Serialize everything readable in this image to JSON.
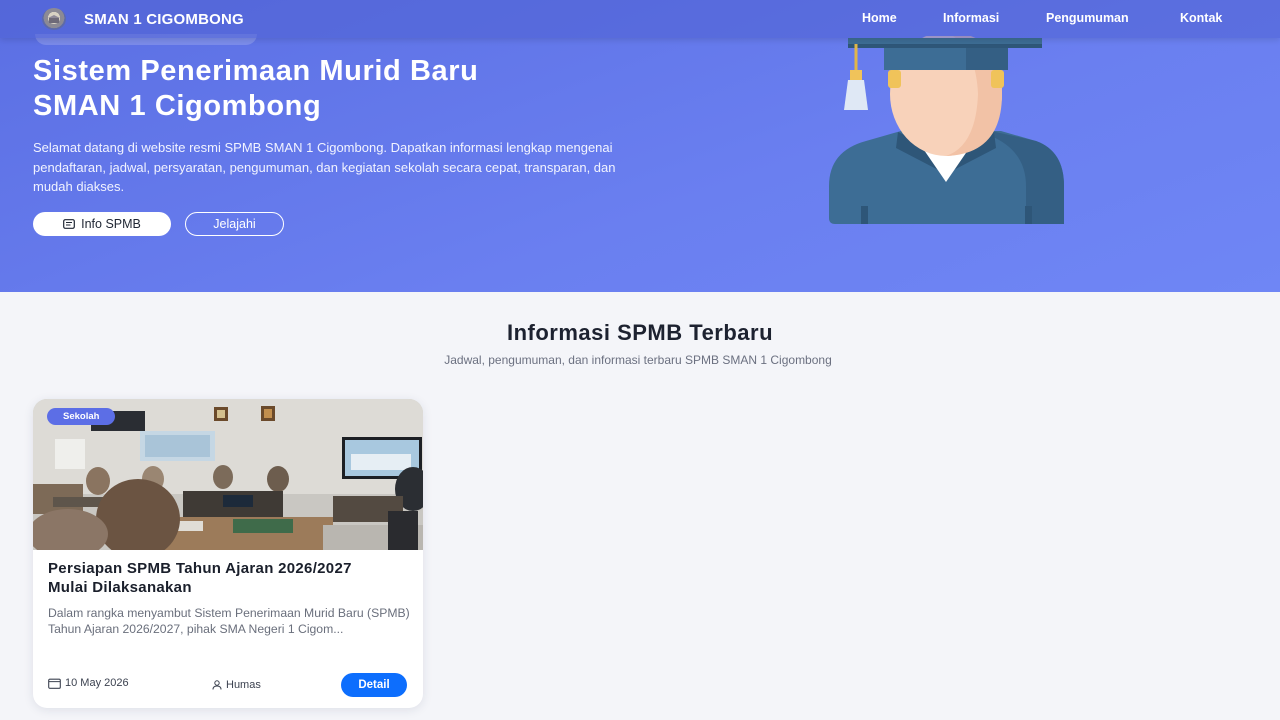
{
  "nav": {
    "brand": "SMAN 1 CIGOMBONG",
    "links": [
      "Home",
      "Informasi",
      "Pengumuman",
      "Kontak"
    ]
  },
  "hero": {
    "title_line1": "Sistem Penerimaan Murid Baru",
    "title_line2": "SMAN 1 Cigombong",
    "description": "Selamat datang di website resmi SPMB SMAN 1 Cigombong. Dapatkan informasi lengkap mengenai pendaftaran, jadwal, persyaratan, pengumuman, dan kegiatan sekolah secara cepat, transparan, dan mudah diakses.",
    "primary_button": "Info SPMB",
    "secondary_button": "Jelajahi",
    "illustration": "graduate-icon"
  },
  "section": {
    "title": "Informasi SPMB Terbaru",
    "subtitle": "Jadwal, pengumuman, dan informasi terbaru SPMB SMAN 1 Cigombong"
  },
  "posts": [
    {
      "category": "Sekolah",
      "title": "Persiapan SPMB Tahun Ajaran 2026/2027 Mulai Dilaksanakan",
      "excerpt": "Dalam rangka menyambut Sistem Penerimaan Murid Baru (SPMB) Tahun Ajaran 2026/2027, pihak SMA Negeri 1 Cigom...",
      "date": "10 May 2026",
      "author": "Humas",
      "button": "Detail"
    }
  ],
  "colors": {
    "hero_gradient_start": "#5b6fe3",
    "hero_gradient_end": "#6f86f5",
    "badge": "#5c6ee6",
    "detail_button": "#0d6efd",
    "page_bg": "#f4f5f9"
  }
}
